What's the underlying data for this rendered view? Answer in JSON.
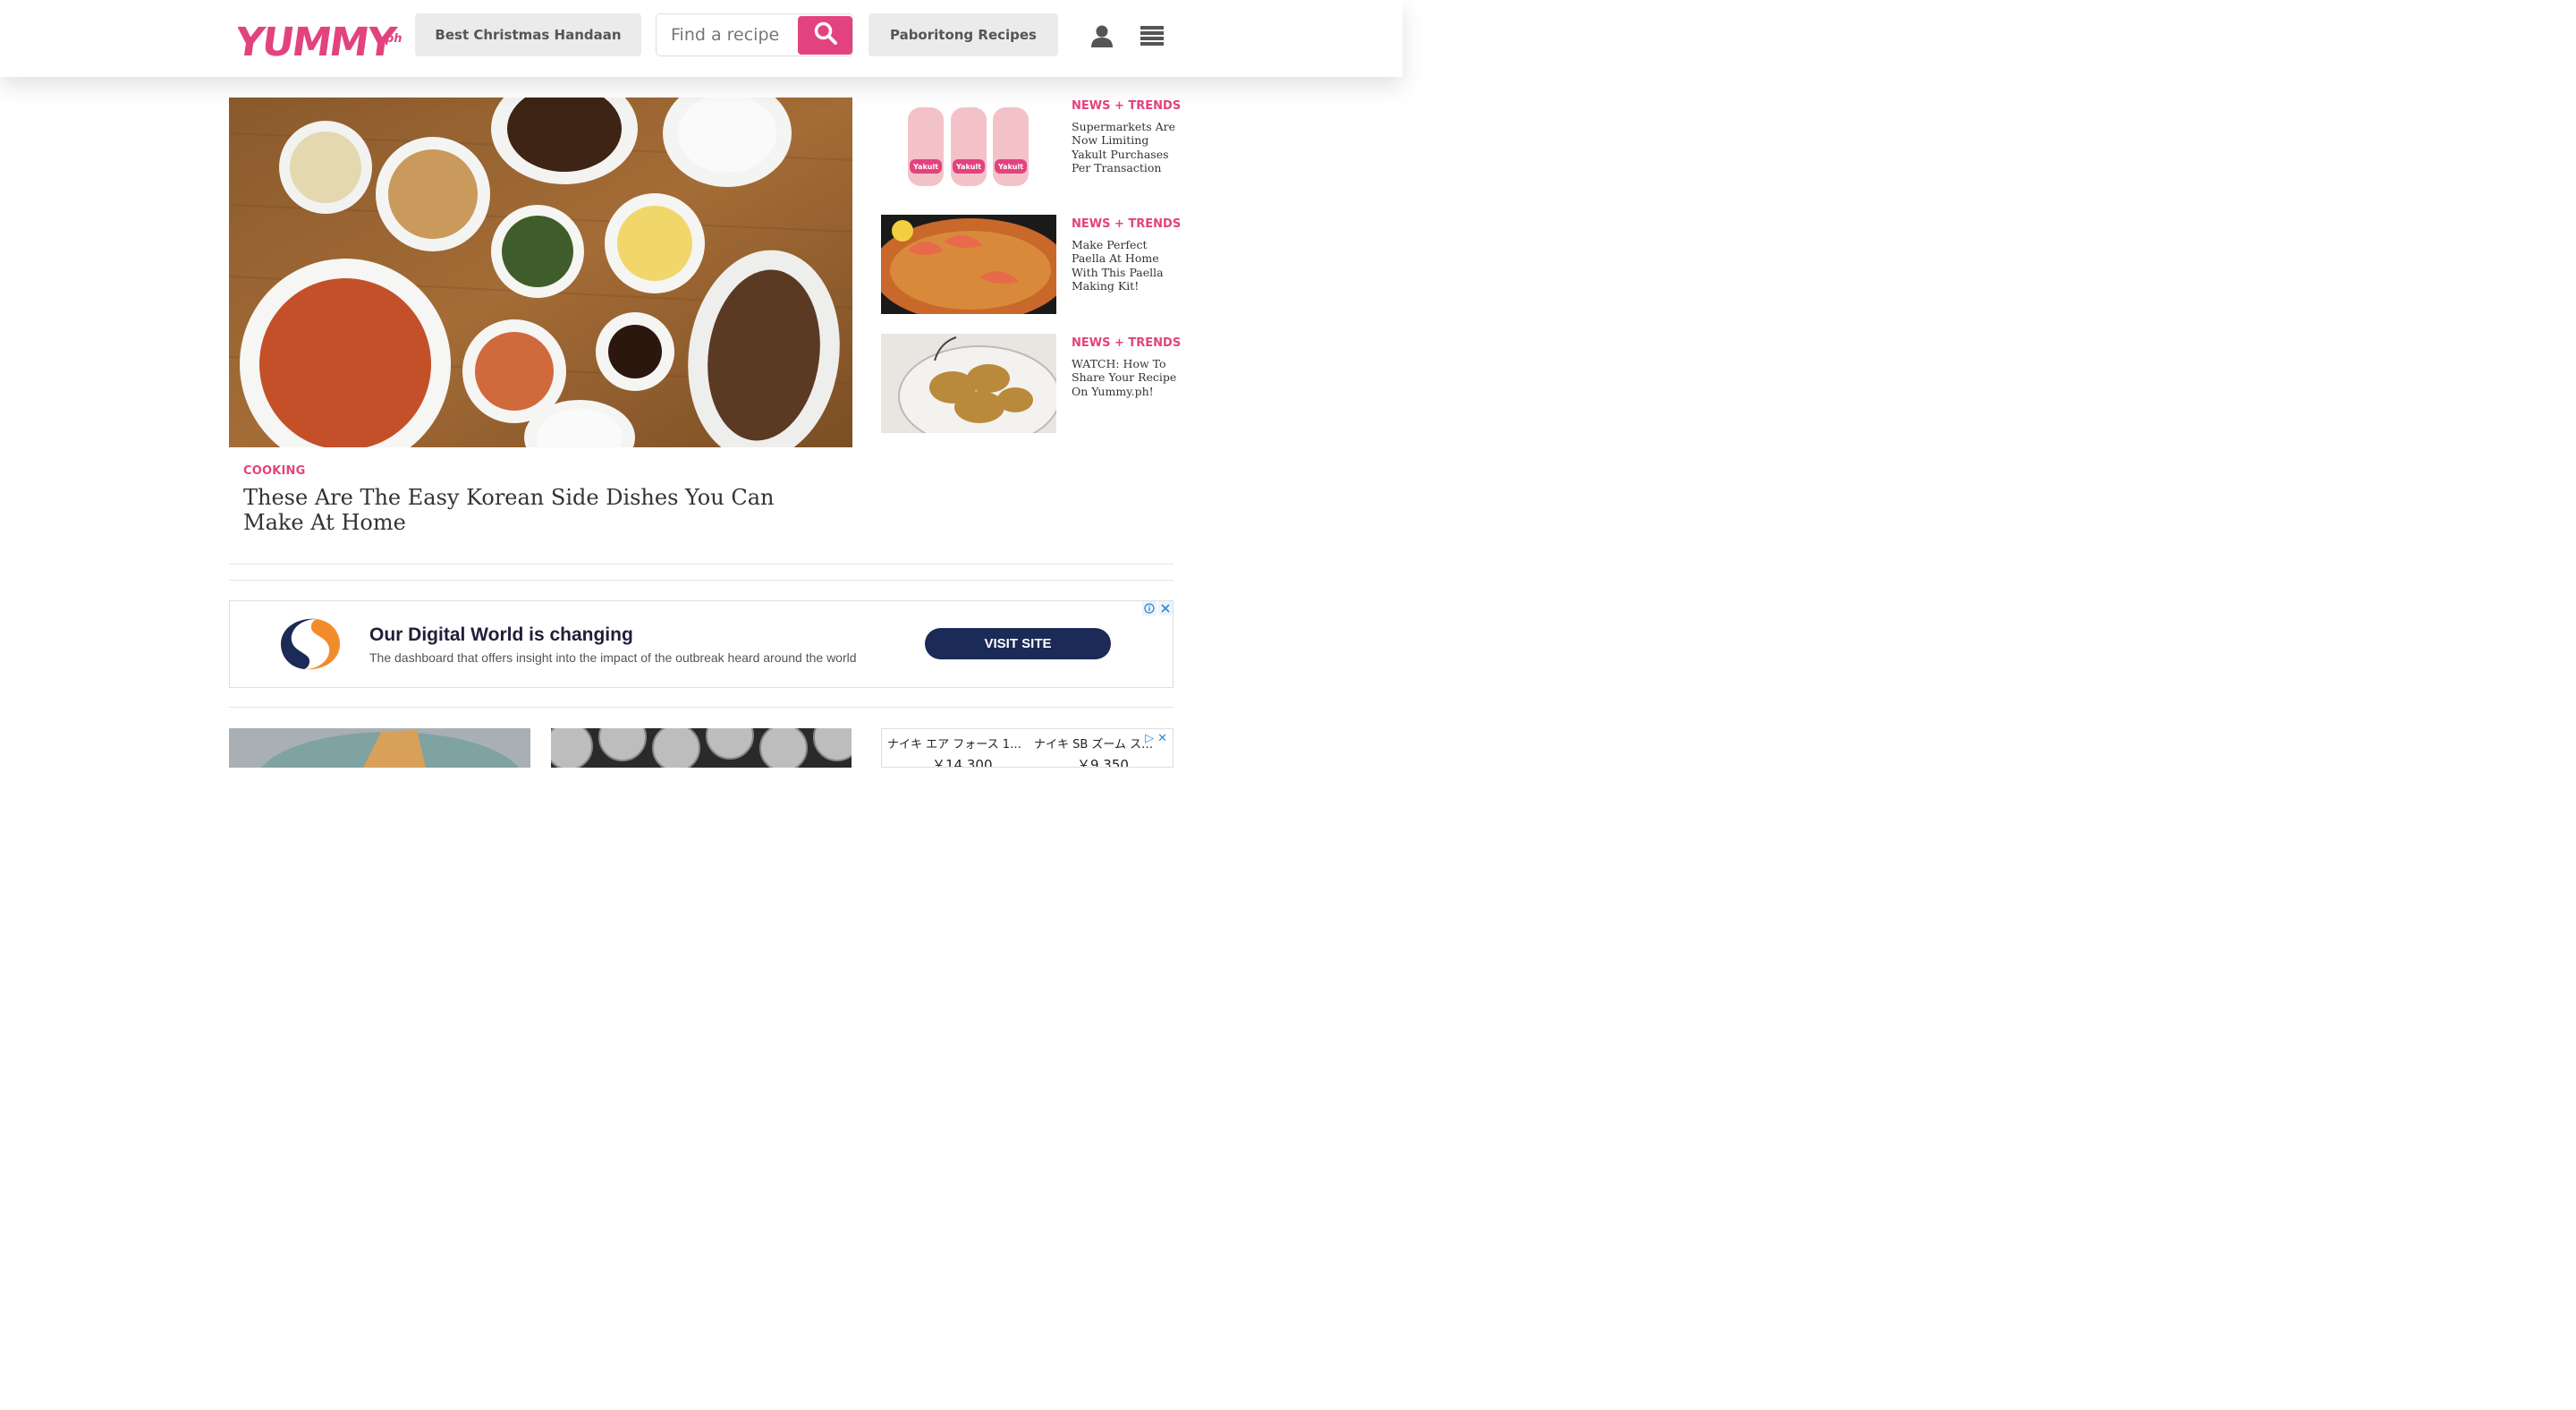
{
  "header": {
    "logo_text": "YUMMY.ph",
    "nav_christmas": "Best Christmas Handaan",
    "search_placeholder": "Find a recipe",
    "nav_paboritong": "Paboritong Recipes",
    "brand_color": "#e2437e",
    "icons": [
      "search-icon",
      "user-icon",
      "menu-icon"
    ]
  },
  "hero": {
    "category": "COOKING",
    "title": "These Are The Easy Korean Side Dishes You Can Make At Home"
  },
  "sidebar": {
    "items": [
      {
        "category": "NEWS + TRENDS",
        "title": "Supermarkets Are Now Limiting Yakult Purchases Per Transaction",
        "bottle_label": "Yakult"
      },
      {
        "category": "NEWS + TRENDS",
        "title": "Make Perfect Paella At Home With This Paella Making Kit!"
      },
      {
        "category": "NEWS + TRENDS",
        "title": "WATCH: How To Share Your Recipe On Yummy.ph!"
      }
    ]
  },
  "ad": {
    "headline": "Our Digital World is changing",
    "text": "The dashboard that offers insight into the impact of the outbreak heard around the world",
    "cta": "VISIT SITE",
    "cta_color": "#1b2a56"
  },
  "shop_ad": {
    "items": [
      {
        "name": "ナイキ エア フォース 1…",
        "price": "￥14,300"
      },
      {
        "name": "ナイキ SB ズーム ス…",
        "price": "￥9,350"
      }
    ]
  }
}
